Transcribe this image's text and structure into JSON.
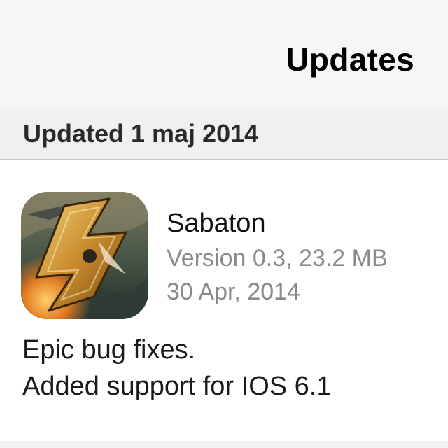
{
  "nav": {
    "title": "Updates"
  },
  "section": {
    "title": "Updated 1 maj 2014"
  },
  "app": {
    "icon": "sabaton-app-icon",
    "name": "Sabaton",
    "version": "Version 0.3, 23.2 MB",
    "date": "30 Apr, 2014",
    "release_notes": [
      "Epic bug fixes.",
      "Added support for IOS 6.1"
    ]
  },
  "colors": {
    "nav_background": "#f5f6f7",
    "section_background": "#f0f0f2",
    "secondary_text": "#8a8a8e",
    "separator": "#c9c9cc"
  }
}
